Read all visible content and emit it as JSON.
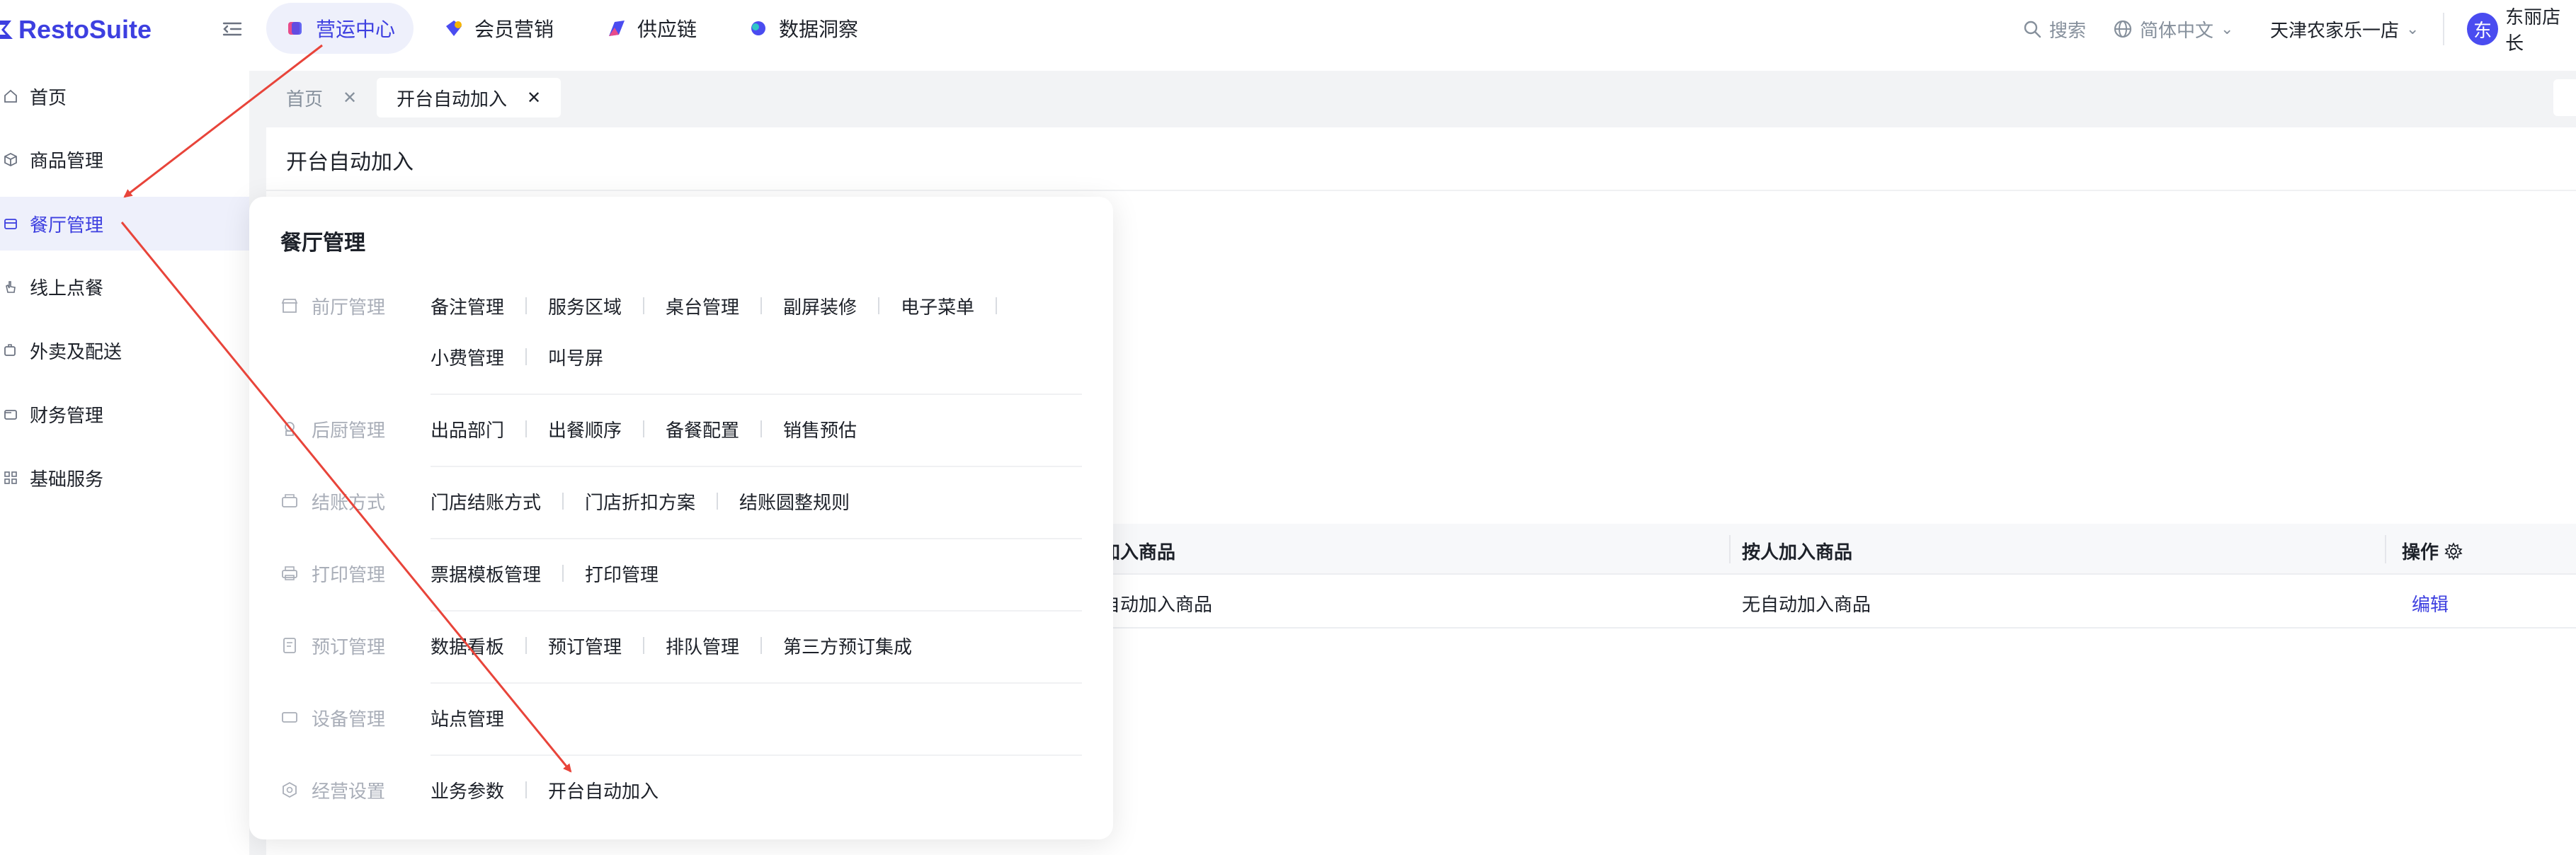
{
  "brand": {
    "name": "RestoSuite",
    "color": "#3d3fe0"
  },
  "topnav": [
    {
      "label": "营运中心",
      "icon": "operations-icon",
      "active": true
    },
    {
      "label": "会员营销",
      "icon": "member-icon",
      "active": false
    },
    {
      "label": "供应链",
      "icon": "supply-chain-icon",
      "active": false
    },
    {
      "label": "数据洞察",
      "icon": "data-insight-icon",
      "active": false
    }
  ],
  "topright": {
    "search": "搜索",
    "language": "简体中文",
    "store": "天津农家乐一店",
    "avatar_initial": "东",
    "user": "东丽店长"
  },
  "sidebar": {
    "items": [
      {
        "label": "首页",
        "icon": "home-icon"
      },
      {
        "label": "商品管理",
        "icon": "box-icon"
      },
      {
        "label": "餐厅管理",
        "icon": "restaurant-icon",
        "active": true
      },
      {
        "label": "线上点餐",
        "icon": "hand-icon"
      },
      {
        "label": "外卖及配送",
        "icon": "delivery-icon"
      },
      {
        "label": "财务管理",
        "icon": "wallet-icon"
      },
      {
        "label": "基础服务",
        "icon": "grid-icon"
      }
    ]
  },
  "tabs": [
    {
      "label": "首页",
      "active": false
    },
    {
      "label": "开台自动加入",
      "active": true
    }
  ],
  "content": {
    "title": "开台自动加入",
    "columns": [
      "加入商品",
      "按人加入商品",
      "操作"
    ],
    "row": [
      "自动加入商品",
      "无自动加入商品",
      "编辑"
    ]
  },
  "panel": {
    "title": "餐厅管理",
    "groups": [
      {
        "label": "前厅管理",
        "icon": "store-icon",
        "rows": [
          [
            "备注管理",
            "服务区域",
            "桌台管理",
            "副屏装修",
            "电子菜单"
          ],
          [
            "小费管理",
            "叫号屏"
          ]
        ]
      },
      {
        "label": "后厨管理",
        "icon": "chef-icon",
        "rows": [
          [
            "出品部门",
            "出餐顺序",
            "备餐配置",
            "销售预估"
          ]
        ]
      },
      {
        "label": "结账方式",
        "icon": "checkout-icon",
        "rows": [
          [
            "门店结账方式",
            "门店折扣方案",
            "结账圆整规则"
          ]
        ]
      },
      {
        "label": "打印管理",
        "icon": "printer-icon",
        "rows": [
          [
            "票据模板管理",
            "打印管理"
          ]
        ]
      },
      {
        "label": "预订管理",
        "icon": "reservation-icon",
        "rows": [
          [
            "数据看板",
            "预订管理",
            "排队管理",
            "第三方预订集成"
          ]
        ]
      },
      {
        "label": "设备管理",
        "icon": "device-icon",
        "rows": [
          [
            "站点管理"
          ]
        ]
      },
      {
        "label": "经营设置",
        "icon": "settings-icon",
        "rows": [
          [
            "业务参数",
            "开台自动加入"
          ]
        ]
      }
    ]
  },
  "annotation_color": "#e8443a"
}
